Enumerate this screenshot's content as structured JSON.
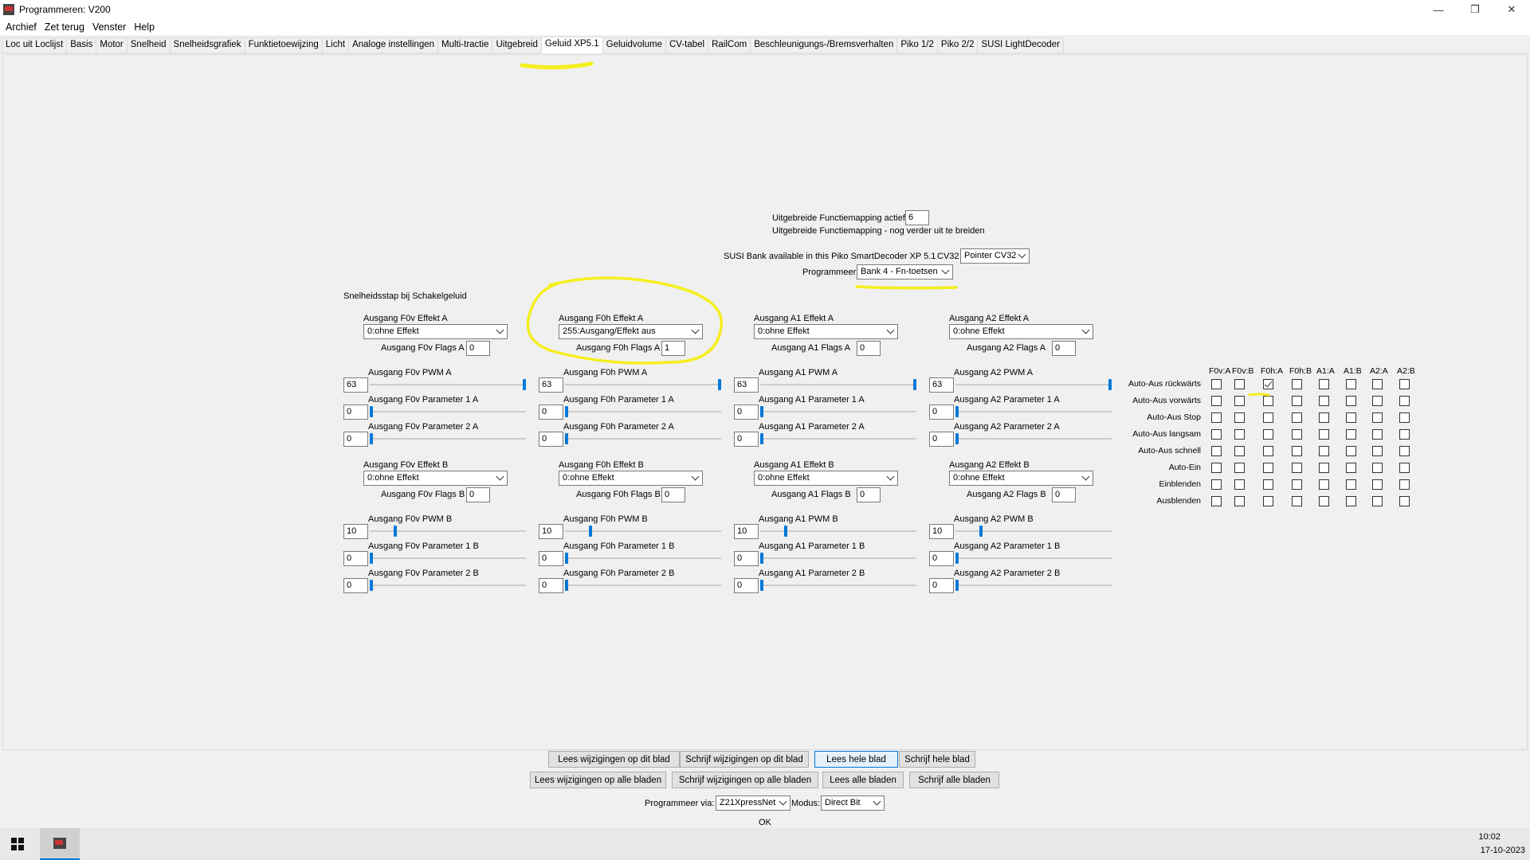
{
  "window": {
    "title": "Programmeren: V200",
    "minimize": "—",
    "restore": "❐",
    "close": "✕"
  },
  "menu": [
    "Archief",
    "Zet terug",
    "Venster",
    "Help"
  ],
  "tabs": [
    "Loc uit Loclijst",
    "Basis",
    "Motor",
    "Snelheid",
    "Snelheidsgrafiek",
    "Funktietoewijzing",
    "Licht",
    "Analoge instellingen",
    "Multi-tractie",
    "Uitgebreid",
    "Geluid XP5.1",
    "Geluidvolume",
    "CV-tabel",
    "RailCom",
    "Beschleunigungs-/Bremsverhalten",
    "Piko 1/2",
    "Piko 2/2",
    "SUSI LightDecoder"
  ],
  "active_tab_index": 10,
  "top": {
    "ext_mapping_label": "Uitgebreide Functiemapping actief",
    "ext_mapping_value": "6",
    "ext_mapping_note": "Uitgebreide Functiemapping - nog verder uit te breiden",
    "susi_label": "SUSI Bank available in this Piko SmartDecoder XP 5.1",
    "cv32_label": "CV32",
    "cv32_value": "Pointer CV32",
    "prog_label": "Programmeer",
    "prog_value": "Bank 4 - Fn-toetsen"
  },
  "speed_step_label": "Snelheidsstap bij Schakelgeluid",
  "outputs": [
    {
      "name": "F0v",
      "effA_label": "Ausgang F0v Effekt A",
      "effA": "0:ohne Effekt",
      "flagsA_label": "Ausgang F0v Flags A",
      "flagsA": "0",
      "pwmA_label": "Ausgang F0v PWM A",
      "pwmA": "63",
      "p1A_label": "Ausgang F0v Parameter 1 A",
      "p1A": "0",
      "p2A_label": "Ausgang F0v Parameter 2 A",
      "p2A": "0",
      "effB_label": "Ausgang F0v Effekt B",
      "effB": "0:ohne Effekt",
      "flagsB_label": "Ausgang F0v Flags B",
      "flagsB": "0",
      "pwmB_label": "Ausgang F0v PWM B",
      "pwmB": "10",
      "p1B_label": "Ausgang F0v Parameter 1 B",
      "p1B": "0",
      "p2B_label": "Ausgang F0v Parameter 2 B",
      "p2B": "0"
    },
    {
      "name": "F0h",
      "effA_label": "Ausgang F0h Effekt A",
      "effA": "255:Ausgang/Effekt aus",
      "flagsA_label": "Ausgang F0h Flags A",
      "flagsA": "1",
      "pwmA_label": "Ausgang F0h PWM A",
      "pwmA": "63",
      "p1A_label": "Ausgang F0h Parameter 1 A",
      "p1A": "0",
      "p2A_label": "Ausgang F0h Parameter 2 A",
      "p2A": "0",
      "effB_label": "Ausgang F0h Effekt B",
      "effB": "0:ohne Effekt",
      "flagsB_label": "Ausgang F0h Flags B",
      "flagsB": "0",
      "pwmB_label": "Ausgang F0h PWM B",
      "pwmB": "10",
      "p1B_label": "Ausgang F0h Parameter 1 B",
      "p1B": "0",
      "p2B_label": "Ausgang F0h Parameter 2 B",
      "p2B": "0"
    },
    {
      "name": "A1",
      "effA_label": "Ausgang A1 Effekt A",
      "effA": "0:ohne Effekt",
      "flagsA_label": "Ausgang A1 Flags A",
      "flagsA": "0",
      "pwmA_label": "Ausgang A1 PWM A",
      "pwmA": "63",
      "p1A_label": "Ausgang A1 Parameter 1 A",
      "p1A": "0",
      "p2A_label": "Ausgang A1 Parameter 2 A",
      "p2A": "0",
      "effB_label": "Ausgang A1 Effekt B",
      "effB": "0:ohne Effekt",
      "flagsB_label": "Ausgang A1 Flags B",
      "flagsB": "0",
      "pwmB_label": "Ausgang A1 PWM B",
      "pwmB": "10",
      "p1B_label": "Ausgang A1 Parameter 1 B",
      "p1B": "0",
      "p2B_label": "Ausgang A1 Parameter 2 B",
      "p2B": "0"
    },
    {
      "name": "A2",
      "effA_label": "Ausgang A2 Effekt A",
      "effA": "0:ohne Effekt",
      "flagsA_label": "Ausgang A2 Flags A",
      "flagsA": "0",
      "pwmA_label": "Ausgang A2 PWM A",
      "pwmA": "63",
      "p1A_label": "Ausgang A2 Parameter 1 A",
      "p1A": "0",
      "p2A_label": "Ausgang A2 Parameter 2 A",
      "p2A": "0",
      "effB_label": "Ausgang A2 Effekt B",
      "effB": "0:ohne Effekt",
      "flagsB_label": "Ausgang A2 Flags B",
      "flagsB": "0",
      "pwmB_label": "Ausgang A2 PWM B",
      "pwmB": "10",
      "p1B_label": "Ausgang A2 Parameter 1 B",
      "p1B": "0",
      "p2B_label": "Ausgang A2 Parameter 2 B",
      "p2B": "0"
    }
  ],
  "slider_max": {
    "pwm": 63,
    "param": 255
  },
  "grid": {
    "columns": [
      "F0v:A",
      "F0v:B",
      "F0h:A",
      "F0h:B",
      "A1:A",
      "A1:B",
      "A2:A",
      "A2:B"
    ],
    "rows": [
      "Auto-Aus rückwärts",
      "Auto-Aus vorwärts",
      "Auto-Aus Stop",
      "Auto-Aus langsam",
      "Auto-Aus schnell",
      "Auto-Ein",
      "Einblenden",
      "Ausblenden"
    ],
    "checked": [
      [
        0,
        2
      ]
    ]
  },
  "buttons_row1": [
    "Lees wijzigingen op dit blad",
    "Schrijf wijzigingen op dit blad",
    "Lees hele blad",
    "Schrijf hele blad"
  ],
  "buttons_row2": [
    "Lees wijzigingen op alle bladen",
    "Schrijf wijzigingen op alle bladen",
    "Lees alle bladen",
    "Schrijf alle bladen"
  ],
  "bottom": {
    "prog_via_label": "Programmeer via:",
    "prog_via_value": "Z21XpressNet",
    "modus_label": "Modus:",
    "modus_value": "Direct Bit",
    "status": "OK"
  },
  "taskbar": {
    "time": "10:02",
    "date": "17-10-2023"
  },
  "annotation_color": "#f5ee1e",
  "accent": "#0078d7"
}
